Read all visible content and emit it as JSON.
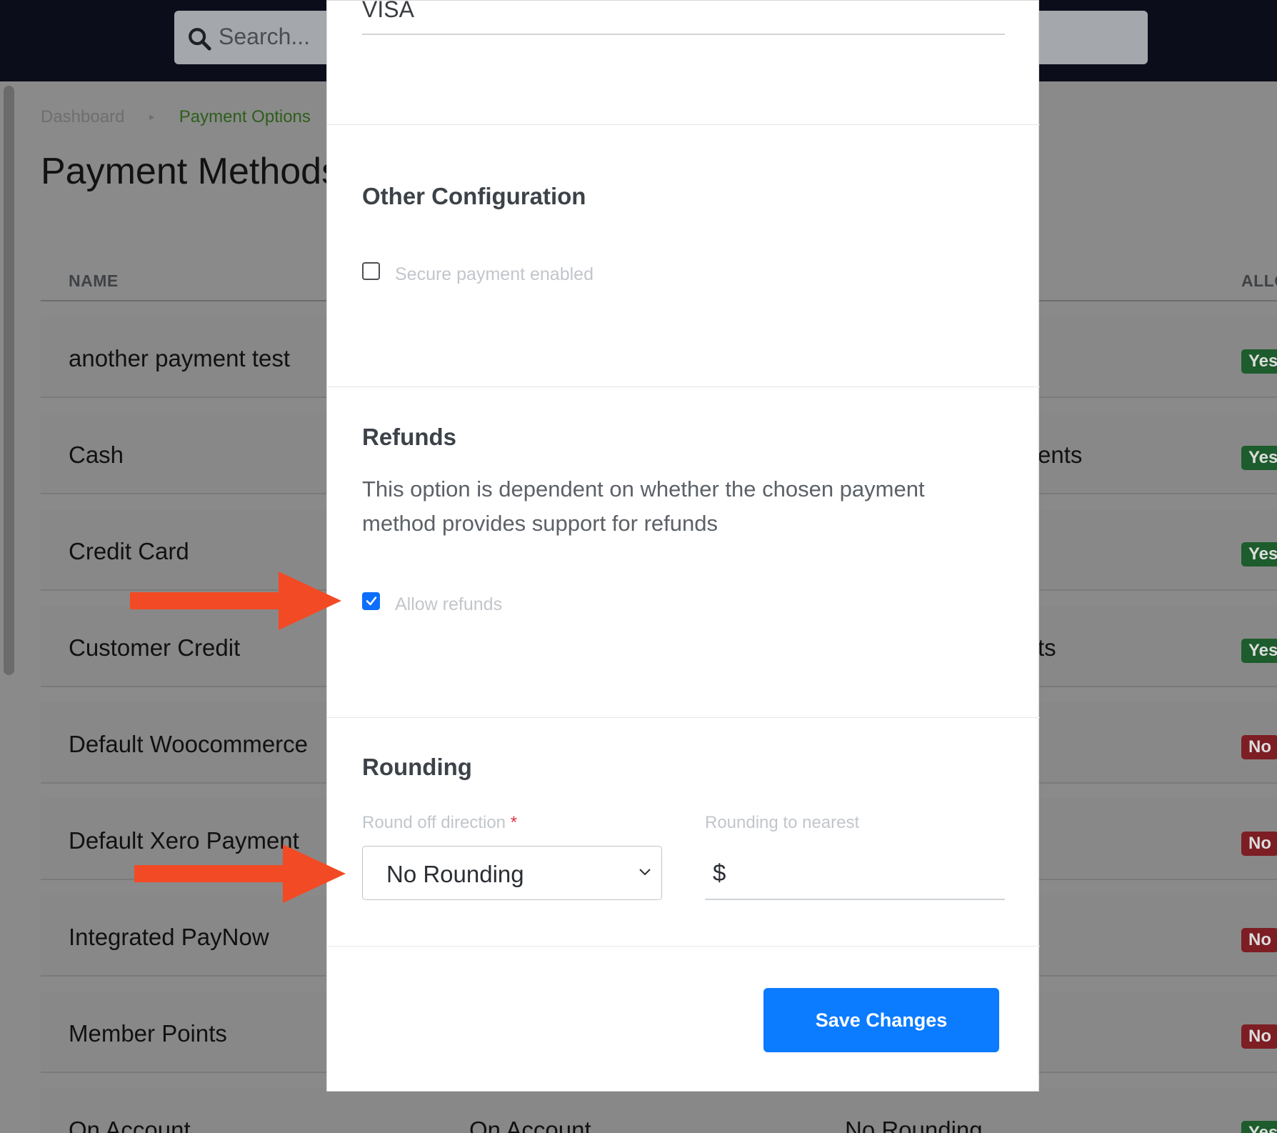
{
  "app": {
    "search_placeholder": "Search..."
  },
  "breadcrumb": {
    "home": "Dashboard",
    "separator": "▸",
    "current": "Payment Options"
  },
  "page": {
    "title": "Payment Methods"
  },
  "table": {
    "columns": {
      "name": "NAME",
      "allow": "ALLO"
    },
    "rows": [
      {
        "name": "another payment test",
        "mid": "",
        "badge": "Yes",
        "status": "yes"
      },
      {
        "name": "Cash",
        "mid": "ents",
        "badge": "Yes",
        "status": "yes"
      },
      {
        "name": "Credit Card",
        "mid": "",
        "badge": "Yes",
        "status": "yes"
      },
      {
        "name": "Customer Credit",
        "mid": "ts",
        "badge": "Yes",
        "status": "yes"
      },
      {
        "name": "Default Woocommerce",
        "mid": "",
        "badge": "No",
        "status": "no"
      },
      {
        "name": "Default Xero Payment",
        "mid": "",
        "badge": "No",
        "status": "no"
      },
      {
        "name": "Integrated PayNow",
        "mid": "",
        "badge": "No",
        "status": "no"
      },
      {
        "name": "Member Points",
        "mid": "",
        "badge": "No",
        "status": "no"
      },
      {
        "name": "On Account",
        "col2": "On Account",
        "col3": "No Rounding",
        "badge": "Yes",
        "status": "yes"
      }
    ]
  },
  "modal": {
    "card_name_value": "VISA",
    "other_config": {
      "title": "Other Configuration",
      "secure_payment_label": "Secure payment enabled",
      "secure_payment_checked": false
    },
    "refunds": {
      "title": "Refunds",
      "description": "This option is dependent on whether the chosen payment method provides support for refunds",
      "allow_refunds_label": "Allow refunds",
      "allow_refunds_checked": true
    },
    "rounding": {
      "title": "Rounding",
      "direction_label": "Round off direction",
      "required_marker": "*",
      "direction_value": "No Rounding",
      "nearest_label": "Rounding to nearest",
      "nearest_prefix": "$",
      "nearest_value": ""
    },
    "save_label": "Save Changes"
  },
  "colors": {
    "primary": "#0b7bff",
    "checkbox_checked": "#0d6efd",
    "annotation_arrow": "#f24a24",
    "badge_yes": "#1d5c2c",
    "badge_no": "#7c1e24"
  }
}
